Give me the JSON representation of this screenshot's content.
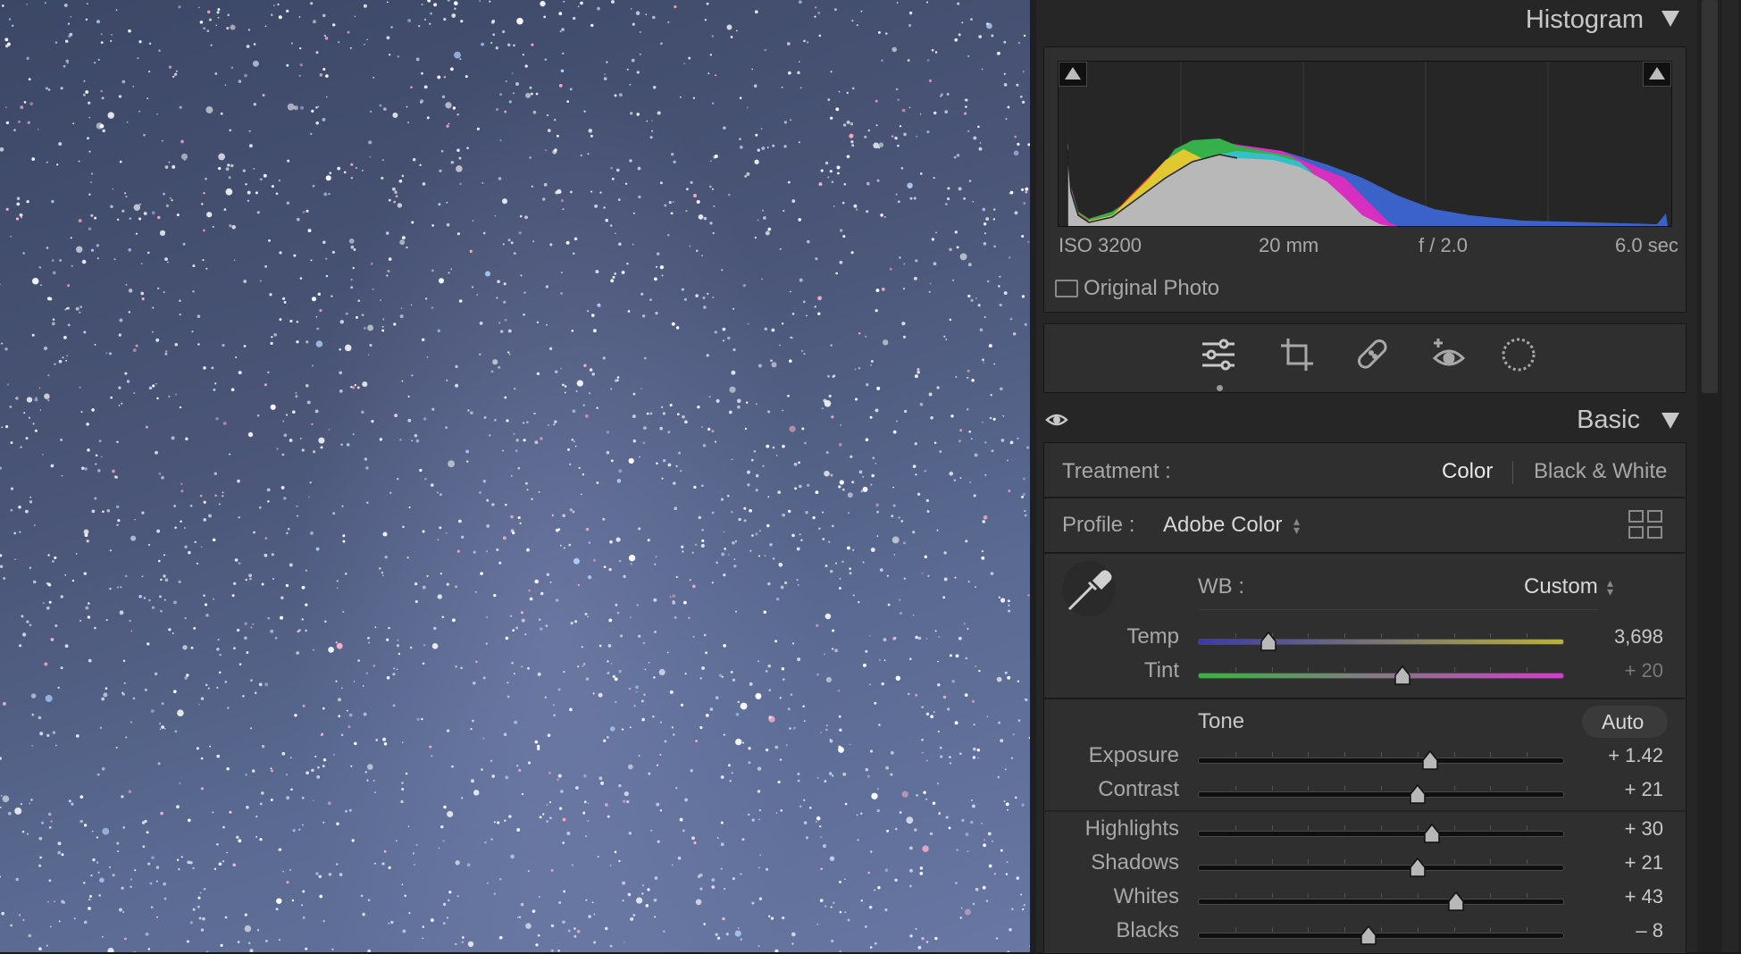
{
  "histogram": {
    "title": "Histogram",
    "iso": "ISO 3200",
    "focal_length": "20 mm",
    "aperture": "f / 2.0",
    "shutter": "6.0 sec",
    "original_photo_label": "Original Photo",
    "original_photo_checked": false
  },
  "tools": [
    "edit-sliders-icon",
    "crop-icon",
    "healing-icon",
    "red-eye-icon",
    "masking-icon"
  ],
  "basic": {
    "title": "Basic",
    "treatment_label": "Treatment :",
    "treatment_color": "Color",
    "treatment_bw": "Black & White",
    "profile_label": "Profile :",
    "profile_value": "Adobe Color",
    "wb_label": "WB :",
    "wb_value": "Custom",
    "tone_label": "Tone",
    "auto_label": "Auto",
    "sliders": {
      "temp": {
        "label": "Temp",
        "value": "3,698",
        "position": 0.19
      },
      "tint": {
        "label": "Tint",
        "value": "+ 20",
        "position": 0.56
      },
      "exposure": {
        "label": "Exposure",
        "value": "+ 1.42",
        "position": 0.635
      },
      "contrast": {
        "label": "Contrast",
        "value": "+ 21",
        "position": 0.6
      },
      "highlights": {
        "label": "Highlights",
        "value": "+ 30",
        "position": 0.64
      },
      "shadows": {
        "label": "Shadows",
        "value": "+ 21",
        "position": 0.6
      },
      "whites": {
        "label": "Whites",
        "value": "+ 43",
        "position": 0.705
      },
      "blacks": {
        "label": "Blacks",
        "value": "– 8",
        "position": 0.465
      }
    }
  },
  "colors": {
    "panel_bg": "#262626",
    "section_bg": "#2f2f2f",
    "text": "#c8c8c8",
    "temp_gradient": [
      "#3a3aa8",
      "#b8b040"
    ],
    "tint_gradient": [
      "#3cb044",
      "#d040c8"
    ]
  }
}
